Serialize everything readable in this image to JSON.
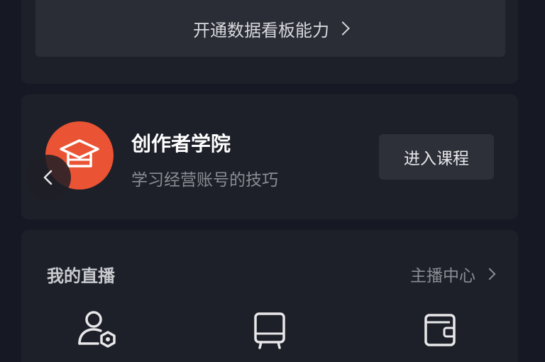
{
  "top_card": {
    "dashboard_button_label": "开通数据看板能力"
  },
  "academy": {
    "title": "创作者学院",
    "subtitle": "学习经营账号的技巧",
    "enter_button_label": "进入课程",
    "icon": "graduation-cap-icon",
    "icon_bg": "#ea5333"
  },
  "live": {
    "title": "我的直播",
    "link_label": "主播中心",
    "icons": [
      "user-settings-icon",
      "luggage-icon",
      "wallet-icon"
    ]
  },
  "colors": {
    "background": "#161823",
    "card": "#1e2029",
    "button": "#2d2f39",
    "accent": "#ea5333"
  }
}
